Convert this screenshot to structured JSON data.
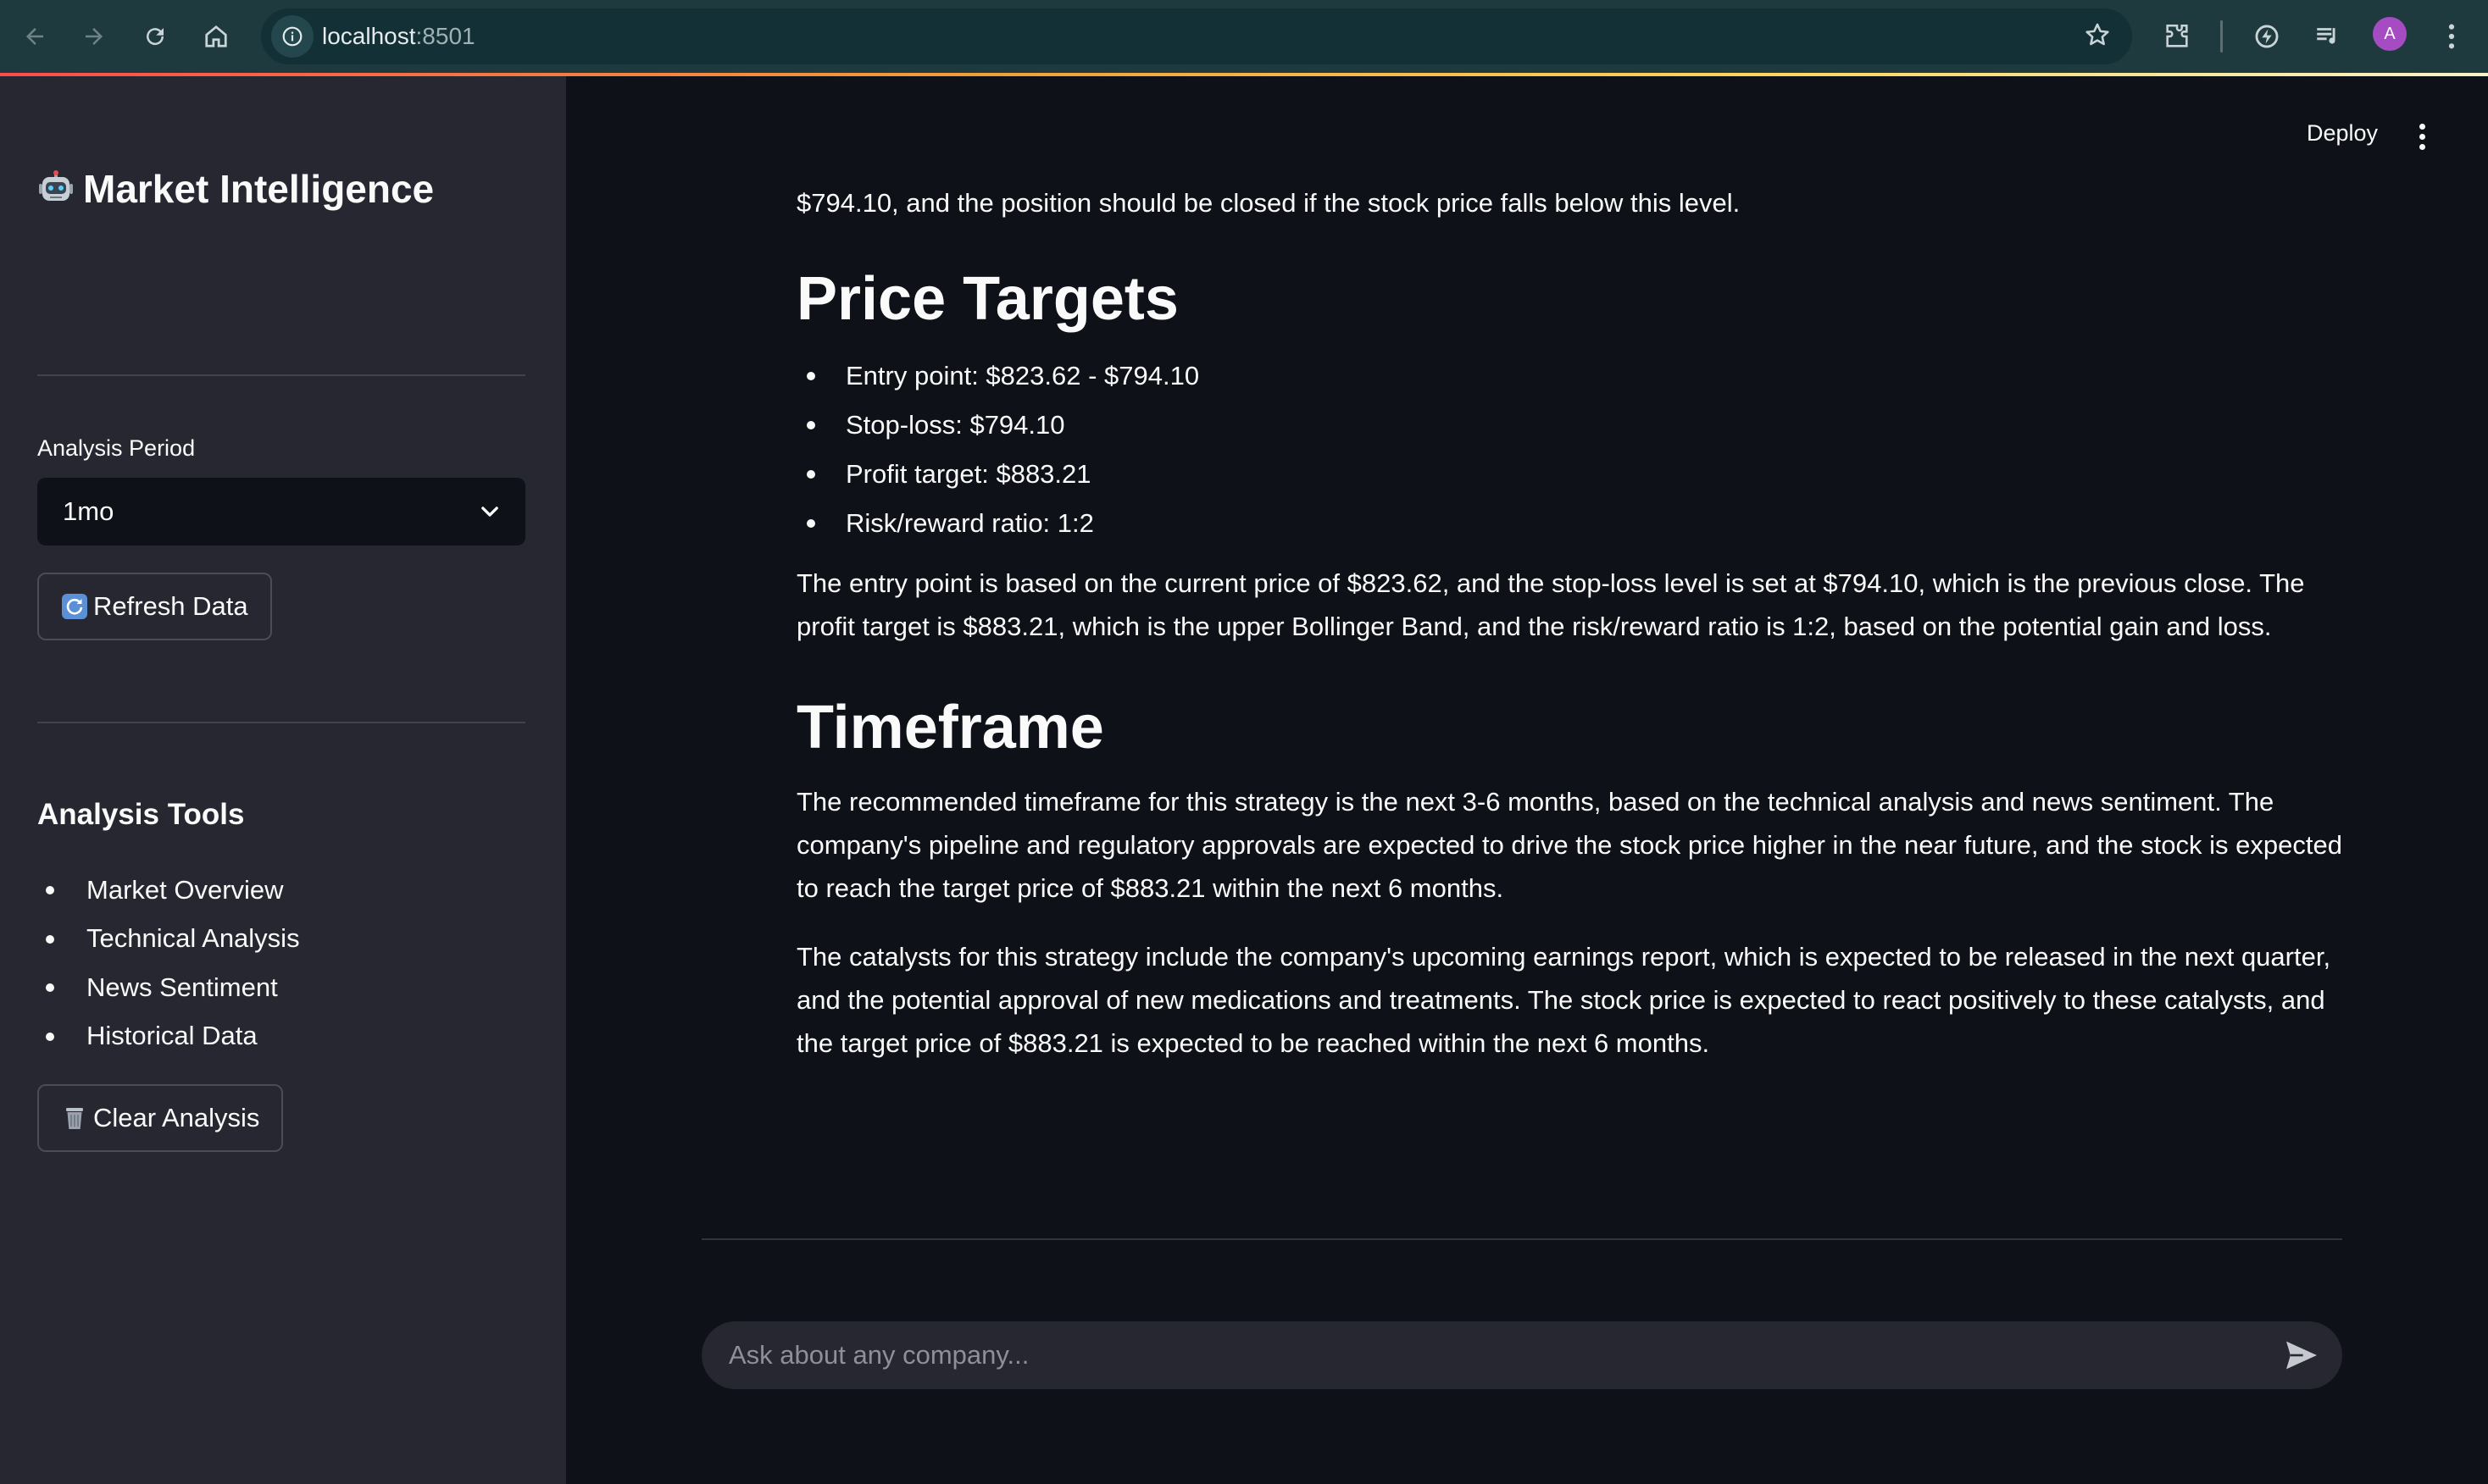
{
  "browser": {
    "url_host": "localhost",
    "url_port": ":8501",
    "profile_initial": "A"
  },
  "sidebar": {
    "title": "Market Intelligence",
    "analysis_period_label": "Analysis Period",
    "analysis_period_value": "1mo",
    "refresh_button": "Refresh Data",
    "tools_heading": "Analysis Tools",
    "tools": [
      "Market Overview",
      "Technical Analysis",
      "News Sentiment",
      "Historical Data"
    ],
    "clear_button": "Clear Analysis"
  },
  "header": {
    "deploy_label": "Deploy"
  },
  "report": {
    "intro_fragment": "$794.10, and the position should be closed if the stock price falls below this level.",
    "price_targets_heading": "Price Targets",
    "price_targets": [
      "Entry point: $823.62 - $794.10",
      "Stop-loss: $794.10",
      "Profit target: $883.21",
      "Risk/reward ratio: 1:2"
    ],
    "price_targets_paragraph": "The entry point is based on the current price of $823.62, and the stop-loss level is set at $794.10, which is the previous close. The profit target is $883.21, which is the upper Bollinger Band, and the risk/reward ratio is 1:2, based on the potential gain and loss.",
    "timeframe_heading": "Timeframe",
    "timeframe_paragraph_1": "The recommended timeframe for this strategy is the next 3-6 months, based on the technical analysis and news sentiment. The company's pipeline and regulatory approvals are expected to drive the stock price higher in the near future, and the stock is expected to reach the target price of $883.21 within the next 6 months.",
    "timeframe_paragraph_2": "The catalysts for this strategy include the company's upcoming earnings report, which is expected to be released in the next quarter, and the potential approval of new medications and treatments. The stock price is expected to react positively to these catalysts, and the target price of $883.21 is expected to be reached within the next 6 months."
  },
  "chat": {
    "placeholder": "Ask about any company..."
  },
  "colors": {
    "sidebar_bg": "#262730",
    "main_bg": "#0e1117",
    "accent_red": "#ff4b4b",
    "text": "#fafafa",
    "chrome_bg": "#1f3a3f"
  }
}
